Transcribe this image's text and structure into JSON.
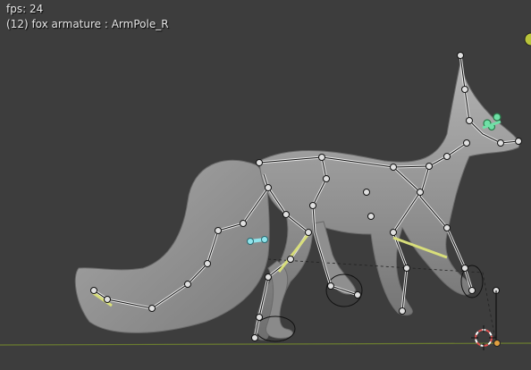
{
  "overlay": {
    "fps_text": "fps: 24",
    "object_info": "(12) fox armature : ArmPole_R"
  },
  "viewport": {
    "background": "#3d3d3d",
    "mesh_color": "#9a9a9a",
    "bone_color": "#1a1a1a",
    "bone_highlight": "#d8de7a",
    "selected_bone_color": "#6fe0a6",
    "ground_line_color": "#6b7d2f"
  }
}
